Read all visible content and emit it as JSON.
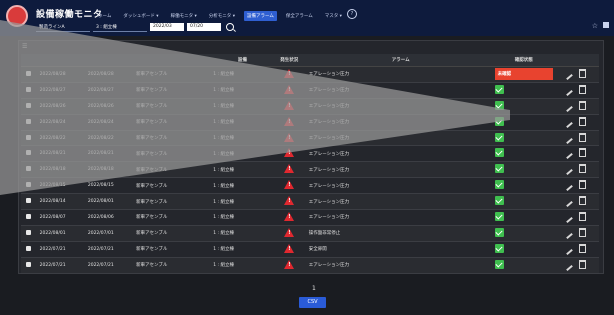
{
  "app": {
    "title": "設備稼働モニタ"
  },
  "nav": [
    {
      "label": "ホーム"
    },
    {
      "label": "ダッシュボード ▾"
    },
    {
      "label": "稼働モニタ ▾"
    },
    {
      "label": "分析モニタ ▾"
    },
    {
      "label": "設備アラーム",
      "active": true
    },
    {
      "label": "保全アラーム"
    },
    {
      "label": "マスタ ▾"
    }
  ],
  "filters": {
    "line": "製造ラインA",
    "area": "3 : 組立棟",
    "from": "2022/03",
    "to": "07/20"
  },
  "table": {
    "headers": [
      "",
      "",
      "",
      "",
      "設備",
      "発生状況",
      "アラーム",
      "確認状態",
      ""
    ],
    "unack_label": "未確認",
    "rows": [
      {
        "a": "2022/08/28",
        "b": "2022/08/28",
        "c": "新車アセンブル",
        "d": "1 : 組立棟",
        "alarm": "エアレーション圧力",
        "status": "unack"
      },
      {
        "a": "2022/08/27",
        "b": "2022/08/27",
        "c": "新車アセンブル",
        "d": "1 : 組立棟",
        "alarm": "エアレーション圧力",
        "status": "ok"
      },
      {
        "a": "2022/08/26",
        "b": "2022/08/26",
        "c": "新車アセンブル",
        "d": "1 : 組立棟",
        "alarm": "エアレーション圧力",
        "status": "ok"
      },
      {
        "a": "2022/08/24",
        "b": "2022/08/24",
        "c": "新車アセンブル",
        "d": "1 : 組立棟",
        "alarm": "エアレーション圧力",
        "status": "ok"
      },
      {
        "a": "2022/08/22",
        "b": "2022/08/22",
        "c": "新車アセンブル",
        "d": "1 : 組立棟",
        "alarm": "エアレーション圧力",
        "status": "ok"
      },
      {
        "a": "2022/08/21",
        "b": "2022/08/21",
        "c": "新車アセンブル",
        "d": "1 : 組立棟",
        "alarm": "エアレーション圧力",
        "status": "ok"
      },
      {
        "a": "2022/08/18",
        "b": "2022/08/18",
        "c": "新車アセンブル",
        "d": "1 : 組立棟",
        "alarm": "エアレーション圧力",
        "status": "ok"
      },
      {
        "a": "2022/08/15",
        "b": "2022/08/15",
        "c": "新車アセンブル",
        "d": "1 : 組立棟",
        "alarm": "エアレーション圧力",
        "status": "ok"
      },
      {
        "a": "2022/08/14",
        "b": "2022/08/01",
        "c": "新車アセンブル",
        "d": "1 : 組立棟",
        "alarm": "エアレーション圧力",
        "status": "ok"
      },
      {
        "a": "2022/08/07",
        "b": "2022/08/06",
        "c": "新車アセンブル",
        "d": "1 : 組立棟",
        "alarm": "エアレーション圧力",
        "status": "ok"
      },
      {
        "a": "2022/08/01",
        "b": "2022/07/01",
        "c": "新車アセンブル",
        "d": "1 : 組立棟",
        "alarm": "操作盤非常停止",
        "status": "ok"
      },
      {
        "a": "2022/07/21",
        "b": "2022/07/21",
        "c": "新車アセンブル",
        "d": "1 : 組立棟",
        "alarm": "安全扉開",
        "status": "ok"
      },
      {
        "a": "2022/07/21",
        "b": "2022/07/21",
        "c": "新車アセンブル",
        "d": "1 : 組立棟",
        "alarm": "エアレーション圧力",
        "status": "ok"
      }
    ]
  },
  "pager": {
    "page": "1"
  },
  "csv_label": "CSV"
}
